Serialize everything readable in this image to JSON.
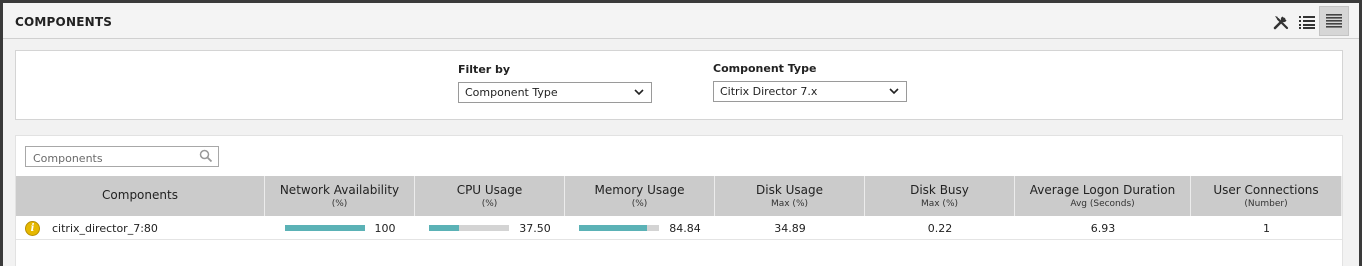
{
  "panel": {
    "title": "COMPONENTS",
    "icons": [
      "tools-icon",
      "list-view-icon",
      "detail-view-icon"
    ]
  },
  "filter": {
    "filter_by_label": "Filter by",
    "filter_by_value": "Component Type",
    "component_type_label": "Component Type",
    "component_type_value": "Citrix Director 7.x"
  },
  "search": {
    "placeholder": "Components"
  },
  "table": {
    "columns": [
      {
        "label": "Components",
        "sub": ""
      },
      {
        "label": "Network Availability",
        "sub": "(%)"
      },
      {
        "label": "CPU Usage",
        "sub": "(%)"
      },
      {
        "label": "Memory Usage",
        "sub": "(%)"
      },
      {
        "label": "Disk Usage",
        "sub": "Max (%)"
      },
      {
        "label": "Disk Busy",
        "sub": "Max (%)"
      },
      {
        "label": "Average Logon Duration",
        "sub": "Avg (Seconds)"
      },
      {
        "label": "User Connections",
        "sub": "(Number)"
      }
    ],
    "rows": [
      {
        "status_icon": "info-icon",
        "name": "citrix_director_7:80",
        "network_availability": "100",
        "network_availability_pct": 100,
        "cpu_usage": "37.50",
        "cpu_usage_pct": 37.5,
        "memory_usage": "84.84",
        "memory_usage_pct": 84.84,
        "disk_usage": "34.89",
        "disk_busy": "0.22",
        "avg_logon_duration": "6.93",
        "user_connections": "1"
      }
    ]
  },
  "colors": {
    "bar_fill": "#5bb2b6",
    "bar_track": "#d4d4d4",
    "header_bg": "#cbcbcb",
    "status_info": "#e6b800"
  }
}
